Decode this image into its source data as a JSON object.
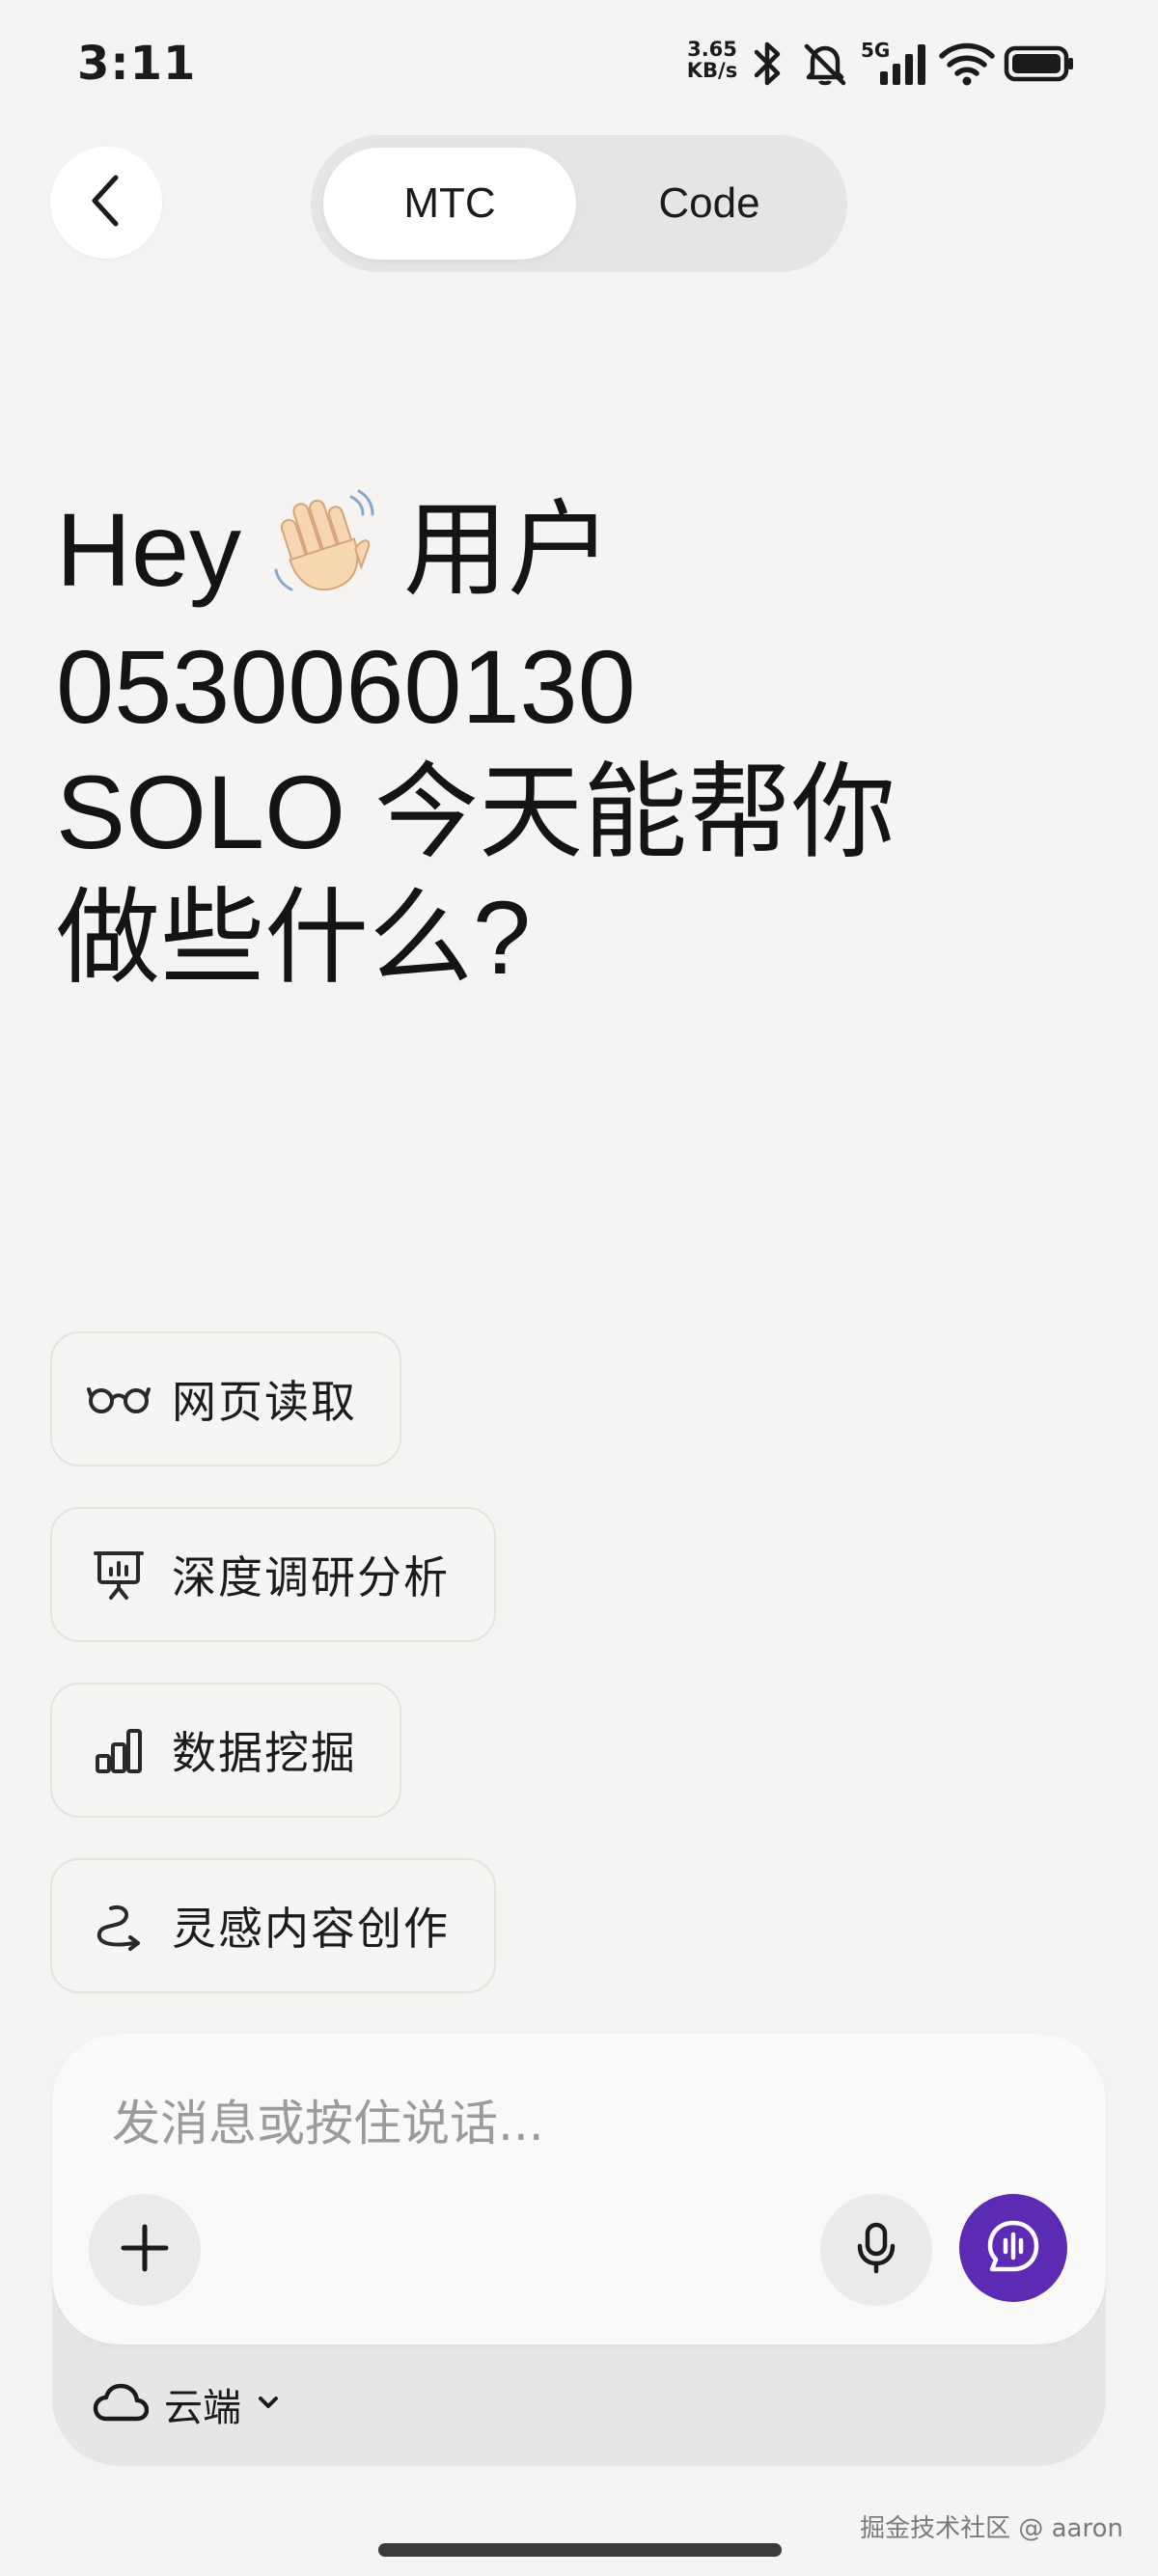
{
  "status_bar": {
    "time": "3:11",
    "speed_value": "3.65",
    "speed_unit": "KB/s",
    "network_label": "5G",
    "icons": [
      "bluetooth-icon",
      "mute-icon",
      "signal-icon",
      "wifi-icon",
      "battery-icon"
    ]
  },
  "header": {
    "back_icon": "chevron-left-icon",
    "tabs": [
      {
        "label": "MTC",
        "active": true
      },
      {
        "label": "Code",
        "active": false
      }
    ]
  },
  "greeting": {
    "line1_prefix": "Hey",
    "line1_emoji": "waving-hand-icon",
    "line1_suffix": "用户",
    "line2": "0530060130",
    "line3": "SOLO 今天能帮你",
    "line4": "做些什么?"
  },
  "quick_actions": [
    {
      "icon": "glasses-icon",
      "label": "网页读取"
    },
    {
      "icon": "presentation-board-icon",
      "label": "深度调研分析"
    },
    {
      "icon": "bar-chart-icon",
      "label": "数据挖掘"
    },
    {
      "icon": "inspiration-icon",
      "label": "灵感内容创作"
    }
  ],
  "composer": {
    "placeholder": "发消息或按住说话...",
    "value": "",
    "environment": "云端",
    "accent_color": "#5b2bb4"
  },
  "watermark": "掘金技术社区 @ aaron"
}
